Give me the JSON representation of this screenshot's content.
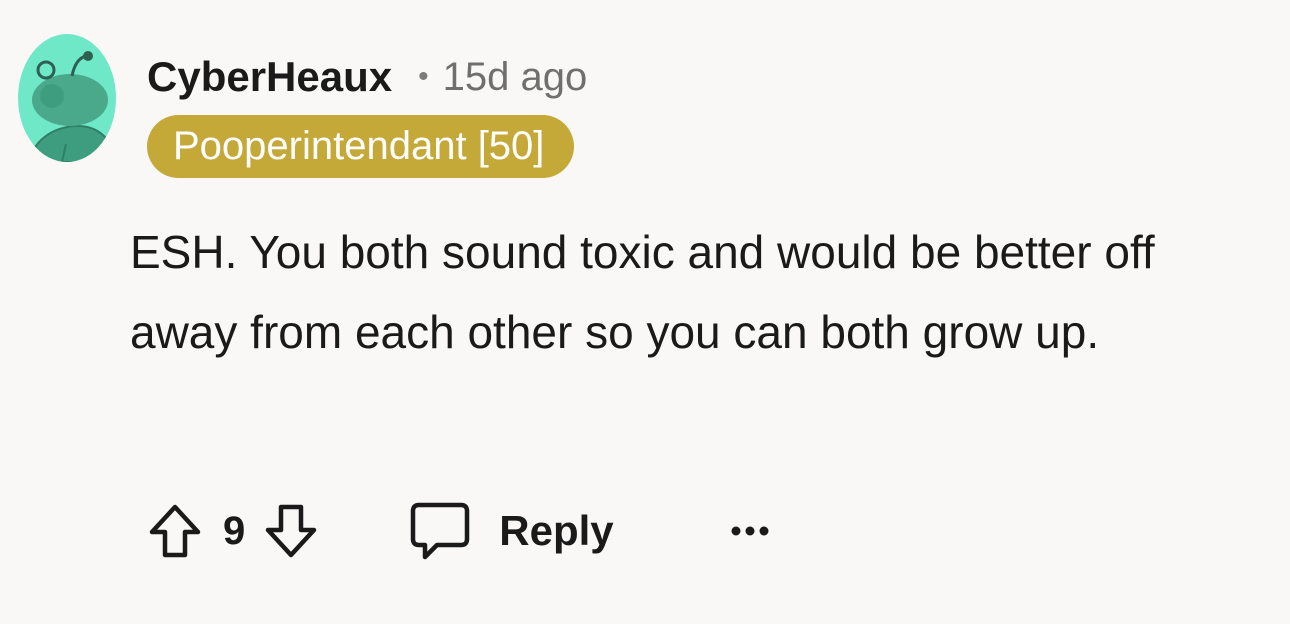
{
  "comment": {
    "author": "CyberHeaux",
    "separator": "•",
    "timestamp": "15d ago",
    "flair": "Pooperintendant [50]",
    "body": "ESH. You both sound toxic and would be better off away from each other so you can both grow up.",
    "vote_count": "9",
    "reply_label": "Reply",
    "more_label": "•••"
  },
  "colors": {
    "background": "#f9f8f6",
    "flair_bg": "#c5a938",
    "avatar_bg": "#6fe8c8",
    "text": "#1a1a1b",
    "muted": "#6f6f6f"
  },
  "icons": {
    "avatar": "snoo-avatar-icon",
    "upvote": "arrow-up-outline-icon",
    "downvote": "arrow-down-outline-icon",
    "reply": "speech-bubble-icon",
    "more": "ellipsis-icon"
  }
}
